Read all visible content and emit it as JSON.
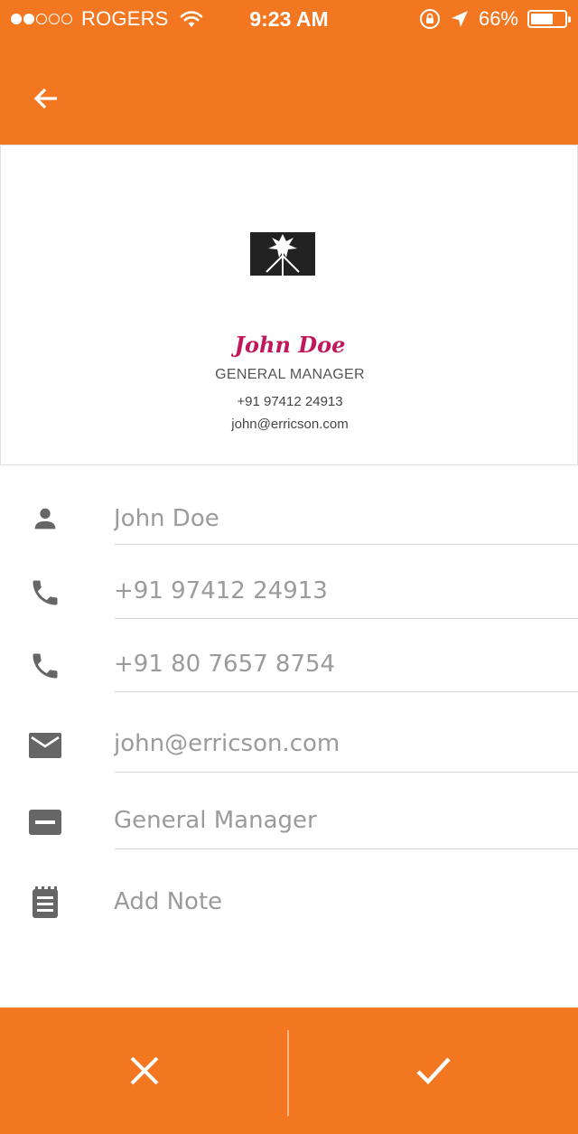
{
  "status_bar": {
    "carrier": "ROGERS",
    "signal_bars_filled": 2,
    "signal_bars_total": 5,
    "time": "9:23 AM",
    "battery_percent": "66%",
    "battery_level": 0.66
  },
  "theme": {
    "accent": "#F37720",
    "name_color": "#C0185B"
  },
  "header": {
    "back_icon": "arrow-left-icon"
  },
  "card": {
    "name": "John Doe",
    "title": "GENERAL MANAGER",
    "phone": "+91 97412 24913",
    "email": "john@erricson.com"
  },
  "form": {
    "name_value": "John Doe",
    "phone1_value": "+91 97412 24913",
    "phone2_value": "+91 80 7657 8754",
    "email_value": "john@erricson.com",
    "designation_value": "General Manager",
    "note_placeholder": "Add Note"
  },
  "actions": {
    "cancel_icon": "close-icon",
    "confirm_icon": "check-icon"
  }
}
